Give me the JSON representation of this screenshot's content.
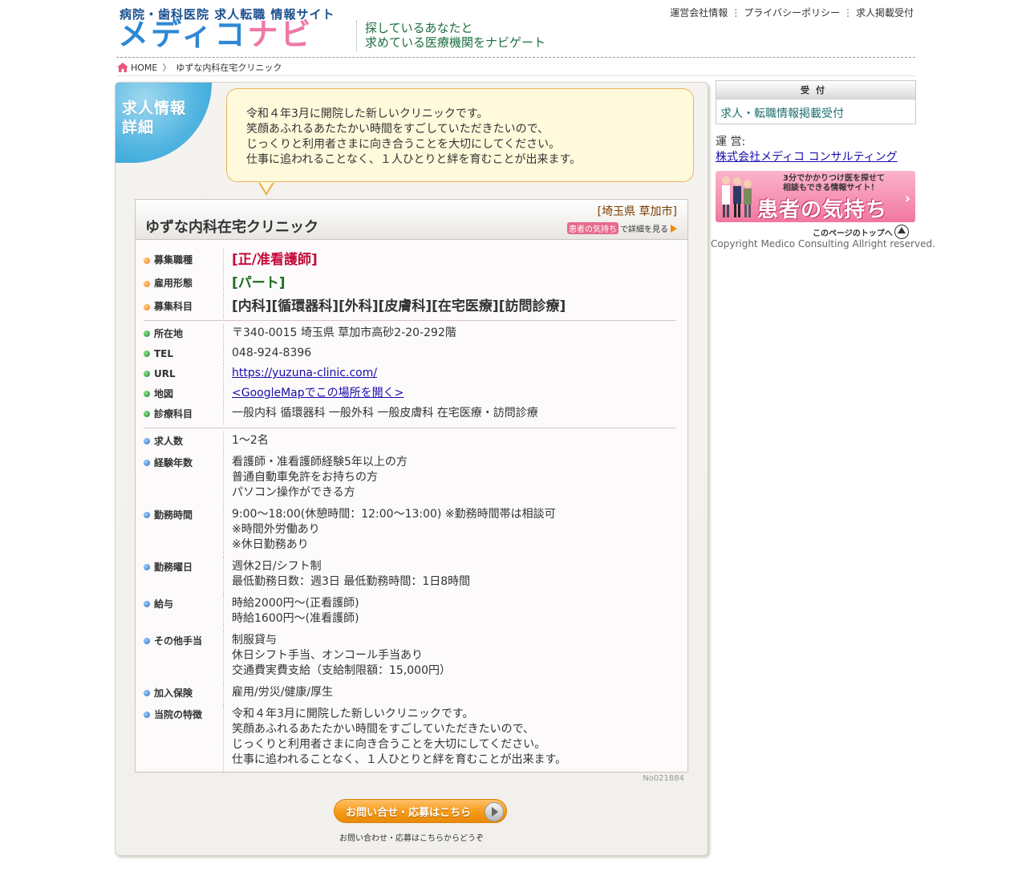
{
  "header": {
    "logo_sub": "病院・歯科医院 求人転職 情報サイト",
    "logo_main_a": "メディコ",
    "logo_main_b": "ナビ",
    "slogan_line1": "探しているあなたと",
    "slogan_line2": "求めている医療機関をナビゲート",
    "nav": [
      "運営会社情報",
      "プライバシーポリシー",
      "求人掲載受付"
    ],
    "nav_sep": "⋮"
  },
  "breadcrumb": {
    "home": "HOME",
    "sep": "〉",
    "current": "ゆずな内科在宅クリニック"
  },
  "section_badge": "求人情報\n詳細",
  "bubble_text": "令和４年3月に開院した新しいクリニックです。\n笑顔あふれるあたたかい時間をすごしていただきたいので、\nじっくりと利用者さまに向き合うことを大切にしてください。\n仕事に追われることなく、１人ひとりと絆を育むことが出来ます。",
  "card": {
    "clinic_name": "ゆずな内科在宅クリニック",
    "location": "[埼玉県 草加市]",
    "patient_tag": "患者の気持ち",
    "patient_link": "で詳細を見る",
    "group1": [
      {
        "label": "募集職種",
        "value": "[正/准看護師]"
      },
      {
        "label": "雇用形態",
        "value": "[パート]"
      },
      {
        "label": "募集科目",
        "value": "[内科][循環器科][外科][皮膚科][在宅医療][訪問診療]"
      }
    ],
    "group2": [
      {
        "label": "所在地",
        "value": "〒340-0015 埼玉県 草加市高砂2-20-292階"
      },
      {
        "label": "TEL",
        "value": "048-924-8396"
      },
      {
        "label": "URL",
        "value": "https://yuzuna-clinic.com/"
      },
      {
        "label": "地図",
        "value": "<GoogleMapでこの場所を開く>"
      },
      {
        "label": "診療科目",
        "value": "一般内科 循環器科 一般外科 一般皮膚科 在宅医療・訪問診療"
      }
    ],
    "group3": [
      {
        "label": "求人数",
        "value": "1〜2名"
      },
      {
        "label": "経験年数",
        "value": "看護師・准看護師経験5年以上の方\n普通自動車免許をお持ちの方\nパソコン操作ができる方"
      },
      {
        "label": "勤務時間",
        "value": "9:00〜18:00(休憩時間：12:00〜13:00) ※勤務時間帯は相談可\n※時間外労働あり\n※休日勤務あり"
      },
      {
        "label": "勤務曜日",
        "value": "週休2日/シフト制\n最低勤務日数：週3日 最低勤務時間：1日8時間"
      },
      {
        "label": "給与",
        "value": "時給2000円〜(正看護師)\n時給1600円〜(准看護師)"
      },
      {
        "label": "その他手当",
        "value": "制服貸与\n休日シフト手当、オンコール手当あり\n交通費実費支給（支給制限額：15,000円）"
      },
      {
        "label": "加入保険",
        "value": "雇用/労災/健康/厚生"
      },
      {
        "label": "当院の特徴",
        "value": "令和４年3月に開院した新しいクリニックです。\n笑顔あふれるあたたかい時間をすごしていただきたいので、\nじっくりと利用者さまに向き合うことを大切にしてください。\n仕事に追われることなく、１人ひとりと絆を育むことが出来ます。"
      }
    ],
    "job_no": "No021884"
  },
  "apply": {
    "button": "お問い合せ・応募はこちら",
    "note": "お問い合わせ・応募はこちらからどうぞ"
  },
  "sidebar": {
    "reception_head": "受付",
    "reception_link": "求人・転職情報掲載受付",
    "operator_label": "運 営:",
    "operator_link": "株式会社メディコ コンサルティング",
    "banner_small": "3分でかかりつけ医を探せて\n相談もできる情報サイト！",
    "banner_big": "患者の気持ち",
    "to_top": "このページのトップへ",
    "copyright": "Copyright Medico Consulting Allright reserved."
  },
  "colors": {
    "brand_blue": "#2f88d4",
    "brand_pink": "#ef78a7",
    "accent_orange": "#f59a16",
    "job_red": "#c40c3c",
    "job_green": "#1d6e1f"
  }
}
